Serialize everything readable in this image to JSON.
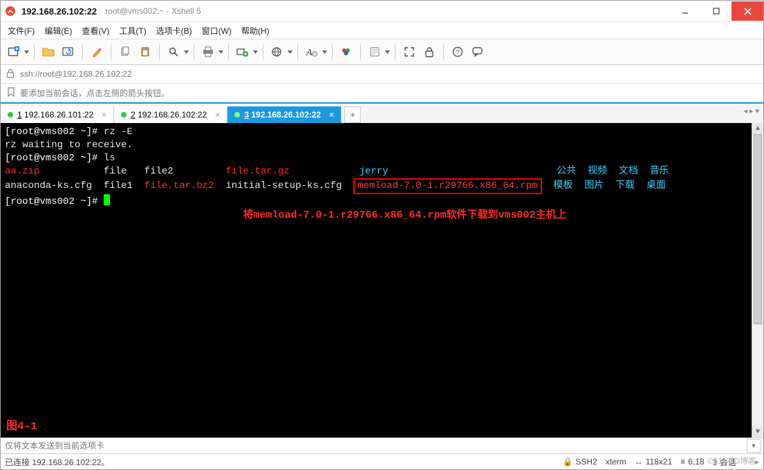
{
  "title": {
    "main": "192.168.26.102:22",
    "sub": "root@vms002:~ - Xshell 5"
  },
  "menu": {
    "file": "文件(F)",
    "edit": "编辑(E)",
    "view": "查看(V)",
    "tool": "工具(T)",
    "tabs": "选项卡(B)",
    "window": "窗口(W)",
    "help": "帮助(H)"
  },
  "address": {
    "url": "ssh://root@192.168.26.102:22"
  },
  "hint": {
    "text": "要添加当前会话，点击左侧的箭头按钮。"
  },
  "tabs": {
    "items": [
      {
        "num": "1",
        "label": "192.168.26.101:22",
        "active": false
      },
      {
        "num": "2",
        "label": "192.168.26.102:22",
        "active": false
      },
      {
        "num": "3",
        "label": "192.168.26.102:22",
        "active": true
      }
    ]
  },
  "terminal": {
    "line1_prompt": "[root@vms002 ~]# ",
    "line1_cmd": "rz -E",
    "line2": "rz waiting to receive.",
    "line3_prompt": "[root@vms002 ~]# ",
    "line3_cmd": "ls",
    "ls_row1": {
      "c1": "aa.zip",
      "c2": "file",
      "c3": "file2",
      "c4": "file.tar.gz",
      "c5": "jerry",
      "r1": "公共",
      "r2": "视频",
      "r3": "文档",
      "r4": "音乐"
    },
    "ls_row2": {
      "c1": "anaconda-ks.cfg",
      "c2": "file1",
      "c3": "file.tar.bz2",
      "c4": "initial-setup-ks.cfg",
      "c5": "memload-7.0-1.r29766.x86_64.rpm",
      "r1": "模板",
      "r2": "图片",
      "r3": "下载",
      "r4": "桌面"
    },
    "line_prompt_end": "[root@vms002 ~]# ",
    "annotation": "将memload-7.0-1.r29766.x86_64.rpm软件下载到vms002主机上",
    "figlabel": "图4-1"
  },
  "sendbar": {
    "placeholder": "仅将文本发送到当前选项卡"
  },
  "status": {
    "conn": "已连接 192.168.26.102:22。",
    "proto": "SSH2",
    "term": "xterm",
    "size": "118x21",
    "pos": "6,18",
    "sess": "3 会话"
  },
  "watermark": "©51CTO博客"
}
